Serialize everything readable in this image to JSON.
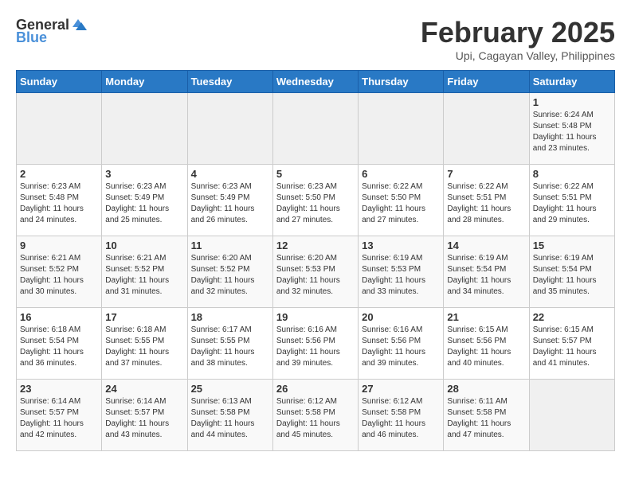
{
  "logo": {
    "text_general": "General",
    "text_blue": "Blue"
  },
  "title": "February 2025",
  "subtitle": "Upi, Cagayan Valley, Philippines",
  "days_of_week": [
    "Sunday",
    "Monday",
    "Tuesday",
    "Wednesday",
    "Thursday",
    "Friday",
    "Saturday"
  ],
  "weeks": [
    [
      {
        "day": "",
        "sunrise": "",
        "sunset": "",
        "daylight": ""
      },
      {
        "day": "",
        "sunrise": "",
        "sunset": "",
        "daylight": ""
      },
      {
        "day": "",
        "sunrise": "",
        "sunset": "",
        "daylight": ""
      },
      {
        "day": "",
        "sunrise": "",
        "sunset": "",
        "daylight": ""
      },
      {
        "day": "",
        "sunrise": "",
        "sunset": "",
        "daylight": ""
      },
      {
        "day": "",
        "sunrise": "",
        "sunset": "",
        "daylight": ""
      },
      {
        "day": "1",
        "sunrise": "Sunrise: 6:24 AM",
        "sunset": "Sunset: 5:48 PM",
        "daylight": "Daylight: 11 hours and 23 minutes."
      }
    ],
    [
      {
        "day": "2",
        "sunrise": "Sunrise: 6:23 AM",
        "sunset": "Sunset: 5:48 PM",
        "daylight": "Daylight: 11 hours and 24 minutes."
      },
      {
        "day": "3",
        "sunrise": "Sunrise: 6:23 AM",
        "sunset": "Sunset: 5:49 PM",
        "daylight": "Daylight: 11 hours and 25 minutes."
      },
      {
        "day": "4",
        "sunrise": "Sunrise: 6:23 AM",
        "sunset": "Sunset: 5:49 PM",
        "daylight": "Daylight: 11 hours and 26 minutes."
      },
      {
        "day": "5",
        "sunrise": "Sunrise: 6:23 AM",
        "sunset": "Sunset: 5:50 PM",
        "daylight": "Daylight: 11 hours and 27 minutes."
      },
      {
        "day": "6",
        "sunrise": "Sunrise: 6:22 AM",
        "sunset": "Sunset: 5:50 PM",
        "daylight": "Daylight: 11 hours and 27 minutes."
      },
      {
        "day": "7",
        "sunrise": "Sunrise: 6:22 AM",
        "sunset": "Sunset: 5:51 PM",
        "daylight": "Daylight: 11 hours and 28 minutes."
      },
      {
        "day": "8",
        "sunrise": "Sunrise: 6:22 AM",
        "sunset": "Sunset: 5:51 PM",
        "daylight": "Daylight: 11 hours and 29 minutes."
      }
    ],
    [
      {
        "day": "9",
        "sunrise": "Sunrise: 6:21 AM",
        "sunset": "Sunset: 5:52 PM",
        "daylight": "Daylight: 11 hours and 30 minutes."
      },
      {
        "day": "10",
        "sunrise": "Sunrise: 6:21 AM",
        "sunset": "Sunset: 5:52 PM",
        "daylight": "Daylight: 11 hours and 31 minutes."
      },
      {
        "day": "11",
        "sunrise": "Sunrise: 6:20 AM",
        "sunset": "Sunset: 5:52 PM",
        "daylight": "Daylight: 11 hours and 32 minutes."
      },
      {
        "day": "12",
        "sunrise": "Sunrise: 6:20 AM",
        "sunset": "Sunset: 5:53 PM",
        "daylight": "Daylight: 11 hours and 32 minutes."
      },
      {
        "day": "13",
        "sunrise": "Sunrise: 6:19 AM",
        "sunset": "Sunset: 5:53 PM",
        "daylight": "Daylight: 11 hours and 33 minutes."
      },
      {
        "day": "14",
        "sunrise": "Sunrise: 6:19 AM",
        "sunset": "Sunset: 5:54 PM",
        "daylight": "Daylight: 11 hours and 34 minutes."
      },
      {
        "day": "15",
        "sunrise": "Sunrise: 6:19 AM",
        "sunset": "Sunset: 5:54 PM",
        "daylight": "Daylight: 11 hours and 35 minutes."
      }
    ],
    [
      {
        "day": "16",
        "sunrise": "Sunrise: 6:18 AM",
        "sunset": "Sunset: 5:54 PM",
        "daylight": "Daylight: 11 hours and 36 minutes."
      },
      {
        "day": "17",
        "sunrise": "Sunrise: 6:18 AM",
        "sunset": "Sunset: 5:55 PM",
        "daylight": "Daylight: 11 hours and 37 minutes."
      },
      {
        "day": "18",
        "sunrise": "Sunrise: 6:17 AM",
        "sunset": "Sunset: 5:55 PM",
        "daylight": "Daylight: 11 hours and 38 minutes."
      },
      {
        "day": "19",
        "sunrise": "Sunrise: 6:16 AM",
        "sunset": "Sunset: 5:56 PM",
        "daylight": "Daylight: 11 hours and 39 minutes."
      },
      {
        "day": "20",
        "sunrise": "Sunrise: 6:16 AM",
        "sunset": "Sunset: 5:56 PM",
        "daylight": "Daylight: 11 hours and 39 minutes."
      },
      {
        "day": "21",
        "sunrise": "Sunrise: 6:15 AM",
        "sunset": "Sunset: 5:56 PM",
        "daylight": "Daylight: 11 hours and 40 minutes."
      },
      {
        "day": "22",
        "sunrise": "Sunrise: 6:15 AM",
        "sunset": "Sunset: 5:57 PM",
        "daylight": "Daylight: 11 hours and 41 minutes."
      }
    ],
    [
      {
        "day": "23",
        "sunrise": "Sunrise: 6:14 AM",
        "sunset": "Sunset: 5:57 PM",
        "daylight": "Daylight: 11 hours and 42 minutes."
      },
      {
        "day": "24",
        "sunrise": "Sunrise: 6:14 AM",
        "sunset": "Sunset: 5:57 PM",
        "daylight": "Daylight: 11 hours and 43 minutes."
      },
      {
        "day": "25",
        "sunrise": "Sunrise: 6:13 AM",
        "sunset": "Sunset: 5:58 PM",
        "daylight": "Daylight: 11 hours and 44 minutes."
      },
      {
        "day": "26",
        "sunrise": "Sunrise: 6:12 AM",
        "sunset": "Sunset: 5:58 PM",
        "daylight": "Daylight: 11 hours and 45 minutes."
      },
      {
        "day": "27",
        "sunrise": "Sunrise: 6:12 AM",
        "sunset": "Sunset: 5:58 PM",
        "daylight": "Daylight: 11 hours and 46 minutes."
      },
      {
        "day": "28",
        "sunrise": "Sunrise: 6:11 AM",
        "sunset": "Sunset: 5:58 PM",
        "daylight": "Daylight: 11 hours and 47 minutes."
      },
      {
        "day": "",
        "sunrise": "",
        "sunset": "",
        "daylight": ""
      }
    ]
  ]
}
